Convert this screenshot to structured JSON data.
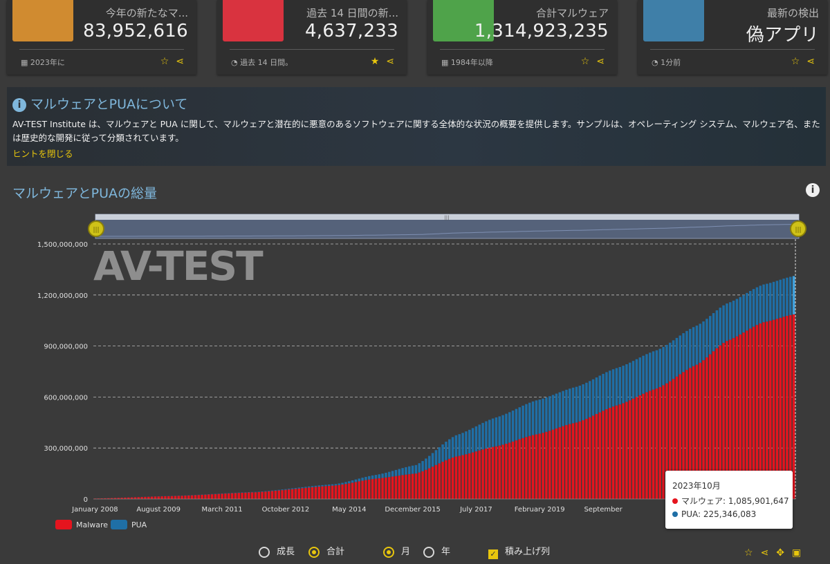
{
  "cards": [
    {
      "label": "今年の新たなマ...",
      "value": "83,952,616",
      "foot": "2023年に",
      "foot_icon": "calendar-icon",
      "color": "#d08b30",
      "icon": "server-stack-icon",
      "starred": false
    },
    {
      "label": "過去 14 日間の新...",
      "value": "4,637,233",
      "foot": "過去 14 日間。",
      "foot_icon": "stopwatch-icon",
      "color": "#d9333f",
      "icon": "flame-icon",
      "starred": true
    },
    {
      "label": "合計マルウェア",
      "value": "1,314,923,235",
      "foot": "1984年以降",
      "foot_icon": "calendar-icon",
      "color": "#4fa34a",
      "icon": "database-icon",
      "starred": false
    },
    {
      "label": "最新の検出",
      "value": "偽アプリ",
      "foot": "1分前",
      "foot_icon": "stopwatch-icon",
      "color": "#3f7fa8",
      "icon": "magnifier-icon",
      "starred": false
    }
  ],
  "info": {
    "title": "マルウェアとPUAについて",
    "text": "AV-TEST Institute は、マルウェアと PUA に関して、マルウェアと潜在的に悪意のあるソフトウェアに関する全体的な状況の概要を提供します。サンプルは、オペレーティング システム、マルウェア名、または歴史的な開発に従って分類されています。",
    "link": "ヒントを閉じる"
  },
  "panel": {
    "title": "マルウェアとPUAの総量",
    "watermark": "AV-TEST"
  },
  "chart_data": {
    "type": "bar",
    "stacked": true,
    "ylim": [
      0,
      1500000000
    ],
    "yticks": [
      "0",
      "300,000,000",
      "600,000,000",
      "900,000,000",
      "1,200,000,000",
      "1,500,000,000"
    ],
    "xticks": [
      "January 2008",
      "August 2009",
      "March 2011",
      "October 2012",
      "May 2014",
      "December 2015",
      "July 2017",
      "February 2019",
      "September"
    ],
    "period": "2008-01 to 2023-10 (monthly)",
    "series": [
      {
        "name": "Malware",
        "color": "#e5141e",
        "anchors": [
          [
            0,
            3000000
          ],
          [
            24,
            18000000
          ],
          [
            48,
            40000000
          ],
          [
            72,
            80000000
          ],
          [
            84,
            120000000
          ],
          [
            96,
            150000000
          ],
          [
            108,
            250000000
          ],
          [
            120,
            310000000
          ],
          [
            132,
            380000000
          ],
          [
            144,
            450000000
          ],
          [
            156,
            550000000
          ],
          [
            168,
            650000000
          ],
          [
            180,
            790000000
          ],
          [
            189,
            930000000
          ],
          [
            200,
            1040000000
          ],
          [
            209,
            1085901647
          ]
        ]
      },
      {
        "name": "PUA",
        "color": "#1f6fa6",
        "anchors": [
          [
            0,
            0
          ],
          [
            48,
            2000000
          ],
          [
            72,
            8000000
          ],
          [
            84,
            22000000
          ],
          [
            96,
            50000000
          ],
          [
            108,
            125000000
          ],
          [
            120,
            170000000
          ],
          [
            132,
            200000000
          ],
          [
            144,
            210000000
          ],
          [
            156,
            220000000
          ],
          [
            168,
            225000000
          ],
          [
            180,
            230000000
          ],
          [
            189,
            220000000
          ],
          [
            200,
            222000000
          ],
          [
            209,
            225346083
          ]
        ]
      }
    ],
    "tooltip": {
      "title": "2023年10月",
      "rows": [
        {
          "label": "マルウェア: 1,085,901,647",
          "color": "#e5141e"
        },
        {
          "label": "PUA: 225,346,083",
          "color": "#1f6fa6"
        }
      ]
    },
    "legend_placement": "bottom-left"
  },
  "controls": {
    "growth": "成長",
    "total": "合計",
    "month": "月",
    "year": "年",
    "stacked": "積み上げ列"
  }
}
